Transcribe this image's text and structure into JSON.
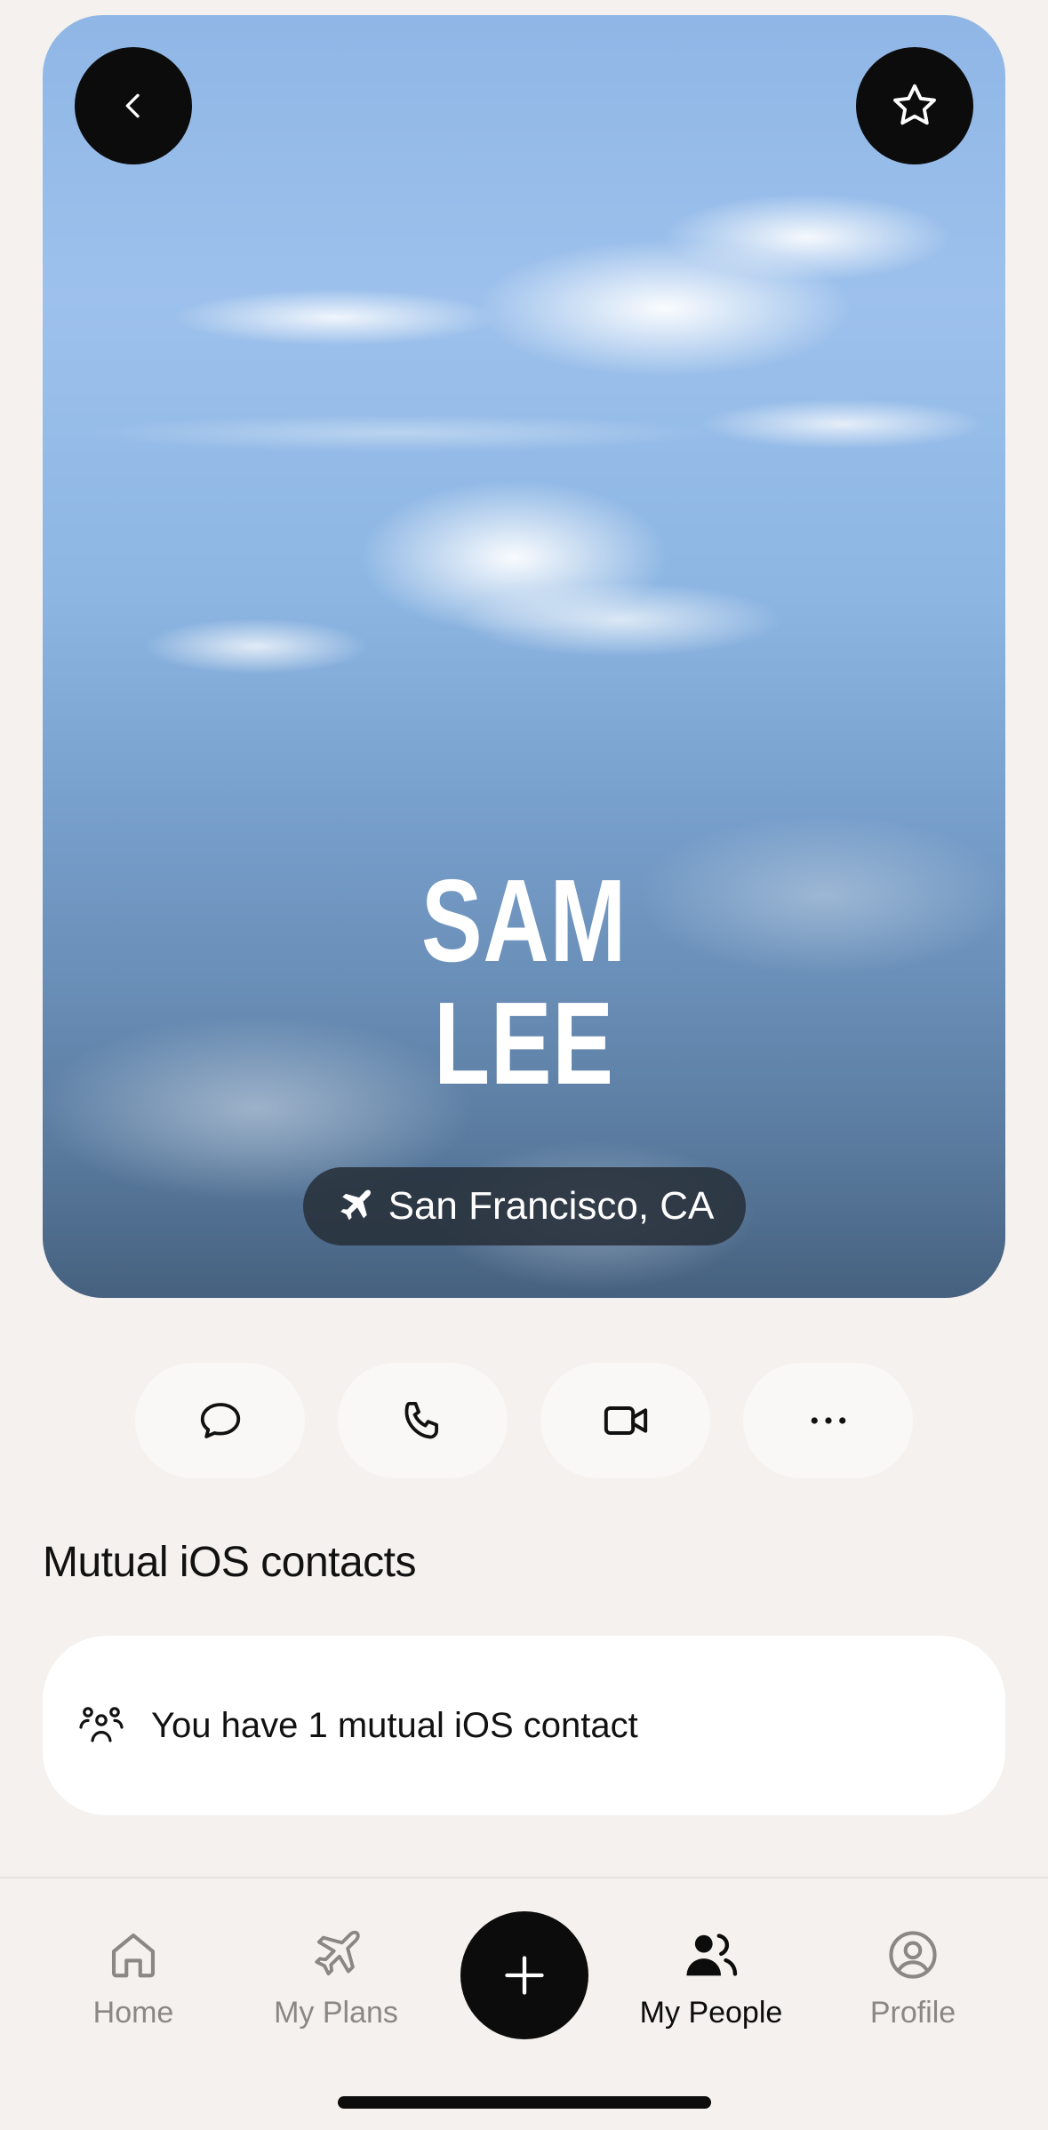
{
  "profile": {
    "first_name": "SAM",
    "last_name": "LEE",
    "location": "San Francisco, CA"
  },
  "header": {
    "back_icon": "chevron-left-icon",
    "favorite_icon": "star-icon"
  },
  "actions": [
    {
      "icon": "message-bubble-icon"
    },
    {
      "icon": "phone-icon"
    },
    {
      "icon": "video-camera-icon"
    },
    {
      "icon": "more-dots-icon"
    }
  ],
  "mutual": {
    "section_title": "Mutual iOS contacts",
    "text": "You have 1 mutual iOS contact",
    "icon": "group-icon"
  },
  "tabbar": {
    "home": "Home",
    "plans": "My Plans",
    "people": "My People",
    "profile": "Profile",
    "active": "My People",
    "add_icon": "plus-icon"
  },
  "colors": {
    "background": "#f4f1ee",
    "accent": "#0c0c0c",
    "inactive_tab": "#8a8784"
  }
}
